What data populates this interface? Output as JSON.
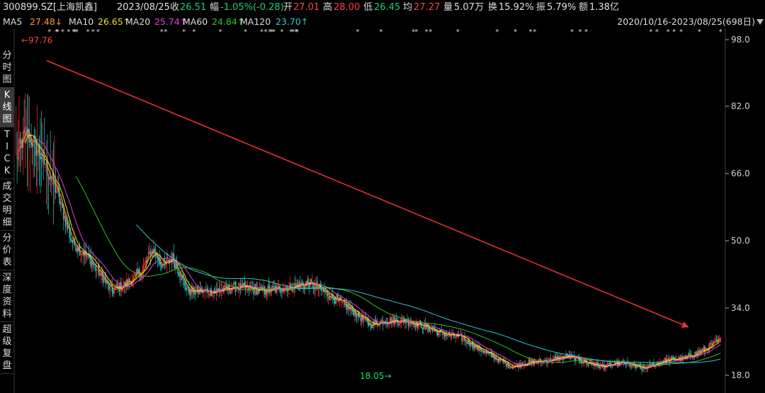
{
  "header": {
    "code": "300899.SZ[上海凯鑫]",
    "date": "2023/08/25",
    "close_label": "收",
    "close": "26.51",
    "change_label": "幅",
    "change": "-1.05%(-0.28)",
    "open_label": "开",
    "open": "27.01",
    "high_label": "高",
    "high": "28.00",
    "low_label": "低",
    "low": "26.45",
    "avg_label": "均",
    "avg": "27.27",
    "vol_label": "量",
    "vol": "5.07万",
    "turnover_label": "换",
    "turnover": "15.92%",
    "amplitude_label": "振",
    "amplitude": "5.79%",
    "amount_label": "额",
    "amount": "1.38亿"
  },
  "ma": [
    {
      "label": "MA5",
      "value": "27.48↓",
      "color": "#ff9b30"
    },
    {
      "label": "MA10",
      "value": "26.65↑",
      "color": "#f0e020"
    },
    {
      "label": "MA20",
      "value": "25.74↑",
      "color": "#e040e0"
    },
    {
      "label": "MA60",
      "value": "24.84↑",
      "color": "#30c030"
    },
    {
      "label": "MA120",
      "value": "23.70↑",
      "color": "#30c8d0"
    }
  ],
  "range_label": "2020/10/16-2023/08/25(698日)",
  "side_tabs": [
    {
      "label": "分时图"
    },
    {
      "label": "K线图"
    },
    {
      "label": "TICK"
    },
    {
      "label": "成交明细"
    },
    {
      "label": "分价表"
    },
    {
      "label": "深度资料"
    },
    {
      "label": "超级复盘"
    }
  ],
  "colors": {
    "up": "#ff3030",
    "down": "#20c8c8",
    "trend_arrow": "#e83030",
    "low_label": "#20e060",
    "high_label": "#ff4040"
  },
  "chart_data": {
    "type": "candlestick",
    "ylim": [
      16,
      100
    ],
    "y_ticks": [
      98.0,
      82.0,
      66.0,
      50.0,
      34.0,
      18.0
    ],
    "y_tick_labels": [
      "98.0",
      "82.0",
      "66.0",
      "50.0",
      "34.0",
      "18.0"
    ],
    "period": "2020/10/16-2023/08/25",
    "bars": 698,
    "high_annotation": "97.76",
    "low_annotation": "18.05",
    "price_path": [
      {
        "i": 0,
        "p": 70
      },
      {
        "i": 10,
        "p": 76
      },
      {
        "i": 25,
        "p": 70
      },
      {
        "i": 40,
        "p": 62
      },
      {
        "i": 55,
        "p": 50
      },
      {
        "i": 75,
        "p": 45
      },
      {
        "i": 95,
        "p": 38
      },
      {
        "i": 110,
        "p": 40
      },
      {
        "i": 125,
        "p": 43
      },
      {
        "i": 135,
        "p": 48
      },
      {
        "i": 145,
        "p": 44
      },
      {
        "i": 155,
        "p": 46
      },
      {
        "i": 170,
        "p": 38
      },
      {
        "i": 195,
        "p": 38
      },
      {
        "i": 220,
        "p": 39
      },
      {
        "i": 245,
        "p": 38
      },
      {
        "i": 270,
        "p": 39
      },
      {
        "i": 290,
        "p": 40
      },
      {
        "i": 310,
        "p": 37
      },
      {
        "i": 335,
        "p": 33
      },
      {
        "i": 350,
        "p": 30
      },
      {
        "i": 365,
        "p": 31
      },
      {
        "i": 385,
        "p": 31
      },
      {
        "i": 400,
        "p": 30
      },
      {
        "i": 420,
        "p": 28
      },
      {
        "i": 440,
        "p": 27
      },
      {
        "i": 460,
        "p": 24
      },
      {
        "i": 475,
        "p": 22
      },
      {
        "i": 490,
        "p": 20
      },
      {
        "i": 505,
        "p": 21
      },
      {
        "i": 525,
        "p": 21.5
      },
      {
        "i": 545,
        "p": 22.5
      },
      {
        "i": 565,
        "p": 21
      },
      {
        "i": 580,
        "p": 20
      },
      {
        "i": 600,
        "p": 21
      },
      {
        "i": 620,
        "p": 19.5
      },
      {
        "i": 640,
        "p": 21.5
      },
      {
        "i": 660,
        "p": 22
      },
      {
        "i": 680,
        "p": 24
      },
      {
        "i": 697,
        "p": 26.5
      }
    ],
    "trend_arrow": {
      "from": {
        "i": 30,
        "p": 93
      },
      "to": {
        "i": 665,
        "p": 29.5
      }
    }
  }
}
